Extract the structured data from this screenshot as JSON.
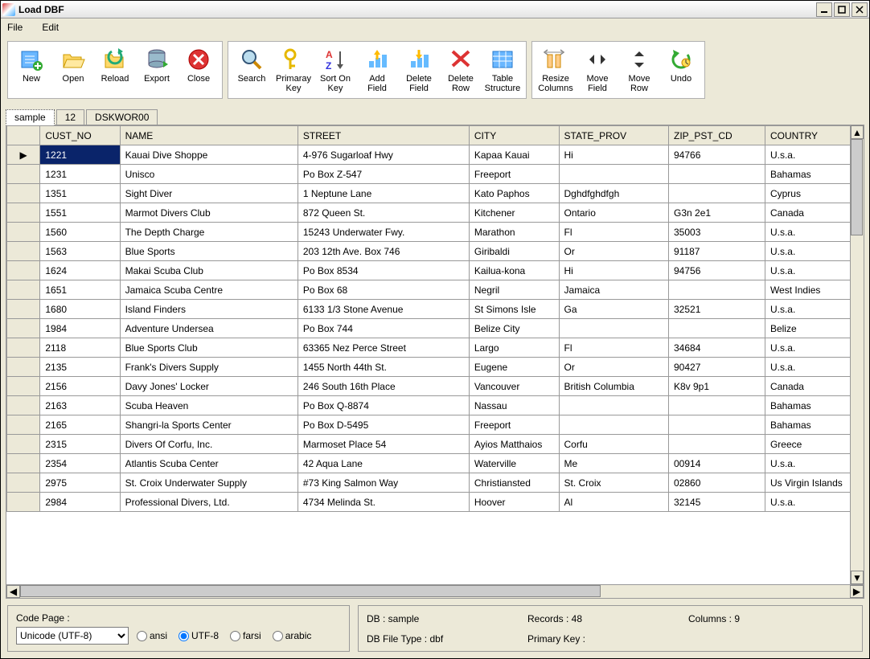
{
  "window_title": "Load DBF",
  "menu": {
    "file": "File",
    "edit": "Edit"
  },
  "toolbar_groups": [
    {
      "items": [
        {
          "id": "new",
          "label": "New",
          "icon": "new"
        },
        {
          "id": "open",
          "label": "Open",
          "icon": "open"
        },
        {
          "id": "reload",
          "label": "Reload",
          "icon": "reload"
        },
        {
          "id": "export",
          "label": "Export",
          "icon": "export"
        },
        {
          "id": "close",
          "label": "Close",
          "icon": "close"
        }
      ]
    },
    {
      "items": [
        {
          "id": "search",
          "label": "Search",
          "icon": "search"
        },
        {
          "id": "primary-key",
          "label": "Primaray\nKey",
          "icon": "key"
        },
        {
          "id": "sort-on-key",
          "label": "Sort On\nKey",
          "icon": "sort"
        },
        {
          "id": "add-field",
          "label": "Add\nField",
          "icon": "add-field"
        },
        {
          "id": "delete-field",
          "label": "Delete\nField",
          "icon": "delete-field"
        },
        {
          "id": "delete-row",
          "label": "Delete\nRow",
          "icon": "delete-row"
        },
        {
          "id": "table-structure",
          "label": "Table\nStructure",
          "icon": "structure"
        }
      ]
    },
    {
      "items": [
        {
          "id": "resize-columns",
          "label": "Resize\nColumns",
          "icon": "resize"
        },
        {
          "id": "move-field",
          "label": "Move\nField",
          "icon": "move-h"
        },
        {
          "id": "move-row",
          "label": "Move\nRow",
          "icon": "move-v"
        },
        {
          "id": "undo",
          "label": "Undo",
          "icon": "undo"
        }
      ]
    }
  ],
  "tabs": [
    {
      "id": "sample",
      "label": "sample",
      "active": true
    },
    {
      "id": "12",
      "label": "12",
      "active": false
    },
    {
      "id": "dskwor00",
      "label": "DSKWOR00",
      "active": false
    }
  ],
  "columns": [
    "CUST_NO",
    "NAME",
    "STREET",
    "CITY",
    "STATE_PROV",
    "ZIP_PST_CD",
    "COUNTRY"
  ],
  "rows": [
    {
      "cust_no": "1221",
      "name": "Kauai Dive Shoppe",
      "street": "4-976 Sugarloaf Hwy",
      "city": "Kapaa Kauai",
      "state": "Hi",
      "zip": "94766",
      "country": "U.s.a.",
      "selected": true,
      "current": true
    },
    {
      "cust_no": "1231",
      "name": "Unisco",
      "street": "Po Box Z-547",
      "city": "Freeport",
      "state": "",
      "zip": "",
      "country": "Bahamas"
    },
    {
      "cust_no": "1351",
      "name": "Sight Diver",
      "street": "1 Neptune Lane",
      "city": "Kato Paphos",
      "state": "Dghdfghdfgh",
      "zip": "",
      "country": "Cyprus"
    },
    {
      "cust_no": "1551",
      "name": "Marmot Divers Club",
      "street": "872 Queen St.",
      "city": "Kitchener",
      "state": "Ontario",
      "zip": "G3n 2e1",
      "country": "Canada"
    },
    {
      "cust_no": "1560",
      "name": "The Depth Charge",
      "street": "15243 Underwater Fwy.",
      "city": "Marathon",
      "state": "Fl",
      "zip": "35003",
      "country": "U.s.a."
    },
    {
      "cust_no": "1563",
      "name": "Blue Sports",
      "street": "203 12th Ave. Box 746",
      "city": "Giribaldi",
      "state": "Or",
      "zip": "91187",
      "country": "U.s.a."
    },
    {
      "cust_no": "1624",
      "name": "Makai Scuba Club",
      "street": "Po Box 8534",
      "city": "Kailua-kona",
      "state": "Hi",
      "zip": "94756",
      "country": "U.s.a."
    },
    {
      "cust_no": "1651",
      "name": "Jamaica Scuba Centre",
      "street": "Po Box 68",
      "city": "Negril",
      "state": "Jamaica",
      "zip": "",
      "country": "West Indies"
    },
    {
      "cust_no": "1680",
      "name": "Island Finders",
      "street": "6133 1/3 Stone Avenue",
      "city": "St Simons Isle",
      "state": "Ga",
      "zip": "32521",
      "country": "U.s.a."
    },
    {
      "cust_no": "1984",
      "name": "Adventure Undersea",
      "street": "Po Box 744",
      "city": "Belize City",
      "state": "",
      "zip": "",
      "country": "Belize"
    },
    {
      "cust_no": "2118",
      "name": "Blue Sports Club",
      "street": "63365 Nez Perce Street",
      "city": "Largo",
      "state": "Fl",
      "zip": "34684",
      "country": "U.s.a."
    },
    {
      "cust_no": "2135",
      "name": "Frank's Divers Supply",
      "street": "1455 North 44th St.",
      "city": "Eugene",
      "state": "Or",
      "zip": "90427",
      "country": "U.s.a."
    },
    {
      "cust_no": "2156",
      "name": "Davy Jones' Locker",
      "street": "246 South 16th Place",
      "city": "Vancouver",
      "state": "British Columbia",
      "zip": "K8v 9p1",
      "country": "Canada"
    },
    {
      "cust_no": "2163",
      "name": "Scuba Heaven",
      "street": "Po Box Q-8874",
      "city": "Nassau",
      "state": "",
      "zip": "",
      "country": "Bahamas"
    },
    {
      "cust_no": "2165",
      "name": "Shangri-la Sports Center",
      "street": "Po Box D-5495",
      "city": "Freeport",
      "state": "",
      "zip": "",
      "country": "Bahamas"
    },
    {
      "cust_no": "2315",
      "name": "Divers Of Corfu, Inc.",
      "street": "Marmoset Place 54",
      "city": "Ayios Matthaios",
      "state": "Corfu",
      "zip": "",
      "country": "Greece"
    },
    {
      "cust_no": "2354",
      "name": "Atlantis Scuba Center",
      "street": "42 Aqua Lane",
      "city": "Waterville",
      "state": "Me",
      "zip": "00914",
      "country": "U.s.a."
    },
    {
      "cust_no": "2975",
      "name": "St. Croix Underwater Supply",
      "street": "#73 King Salmon Way",
      "city": "Christiansted",
      "state": "St. Croix",
      "zip": "02860",
      "country": "Us Virgin Islands"
    },
    {
      "cust_no": "2984",
      "name": "Professional Divers, Ltd.",
      "street": "4734 Melinda St.",
      "city": "Hoover",
      "state": "Al",
      "zip": "32145",
      "country": "U.s.a."
    }
  ],
  "codepage": {
    "label": "Code Page :",
    "selected": "Unicode (UTF-8)",
    "radios": [
      {
        "id": "ansi",
        "label": "ansi",
        "checked": false
      },
      {
        "id": "utf8",
        "label": "UTF-8",
        "checked": true
      },
      {
        "id": "farsi",
        "label": "farsi",
        "checked": false
      },
      {
        "id": "arabic",
        "label": "arabic",
        "checked": false
      }
    ]
  },
  "status": {
    "db": "DB : sample",
    "records": "Records : 48",
    "columns": "Columns : 9",
    "filetype": "DB File Type : dbf",
    "pk": "Primary Key :"
  }
}
